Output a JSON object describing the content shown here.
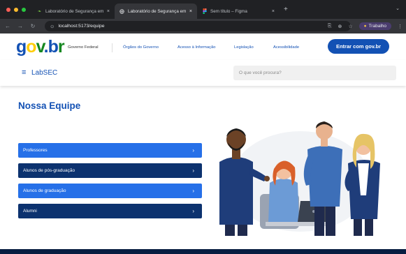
{
  "browser": {
    "tabs": [
      {
        "label": "Laboratório de Segurança em",
        "icon": "leaf-favicon-icon",
        "active": false
      },
      {
        "label": "Laboratório de Segurança em",
        "icon": "globe-favicon-icon",
        "active": true
      },
      {
        "label": "Sem título – Figma",
        "icon": "figma-favicon-icon",
        "active": false
      }
    ],
    "close_glyph": "×",
    "new_tab_glyph": "+",
    "chevron_glyph": "⌄",
    "url": "localhost:5173/equipe",
    "profile_label": "Trabalho"
  },
  "gov_header": {
    "logo": {
      "g": "g",
      "o1": "o",
      "v": "v",
      "dot": ".",
      "b": "b",
      "r": "r"
    },
    "government_label": "Governo Federal",
    "links": [
      "Órgãos do Governo",
      "Acesso à Informação",
      "Legislação",
      "Acessibilidade"
    ],
    "login_button": "Entrar com gov.br"
  },
  "site_header": {
    "menu_glyph": "≡",
    "title": "LabSEC",
    "search_placeholder": "O que você procura?"
  },
  "page": {
    "title": "Nossa Equipe",
    "menu_items": [
      {
        "label": "Professores",
        "style": "light"
      },
      {
        "label": "Alunos de pós-graduação",
        "style": "dark"
      },
      {
        "label": "Alunos de graduação",
        "style": "light"
      },
      {
        "label": "Alumni",
        "style": "dark"
      }
    ],
    "menu_chevron": "›"
  },
  "colors": {
    "gov_blue": "#1351b4",
    "dark_blue": "#071d41",
    "menu_light": "#2670e8",
    "menu_dark": "#0c326f",
    "logo_blue": "#1351b4",
    "logo_yellow": "#ffcd07",
    "logo_green": "#168821",
    "browser_dark": "#202124"
  }
}
